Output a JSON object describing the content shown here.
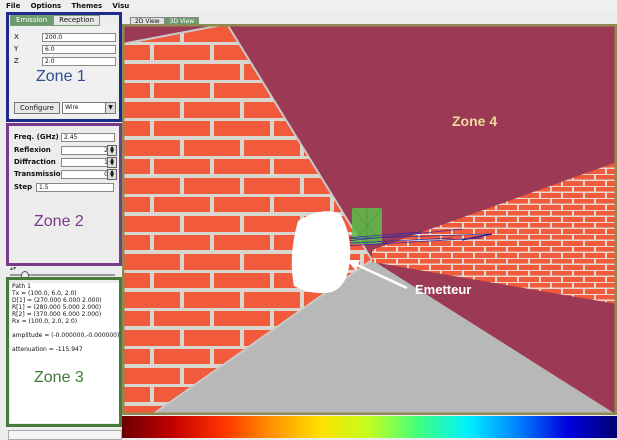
{
  "menu": [
    "File",
    "Options",
    "Themes",
    "Visu"
  ],
  "zone1": {
    "tabs": [
      "Emission",
      "Reception"
    ],
    "fields": [
      {
        "label": "X",
        "value": "200.0"
      },
      {
        "label": "Y",
        "value": "6.0"
      },
      {
        "label": "Z",
        "value": "2.0"
      }
    ],
    "title": "Zone 1",
    "configure": "Configure",
    "mode": "Wire",
    "border_color": "#1e2a8c"
  },
  "zone2": {
    "freq_label": "Freq. (GHz)",
    "freq_value": "2.45",
    "params": [
      {
        "label": "Reflexion",
        "value": "2"
      },
      {
        "label": "Diffraction",
        "value": "1"
      },
      {
        "label": "Transmission",
        "value": "0"
      }
    ],
    "step_label": "Step",
    "step_value": "1.5",
    "title": "Zone 2",
    "border_color": "#7a3a8c"
  },
  "zone3": {
    "lines": [
      "Path 1",
      "Tx = (100.0, 6.0, 2.0)",
      "D[1] = (270.000 6.000 2.000)",
      "R[1] = (280.000 5.000 2.000)",
      "R[2] = (370.000 6.000 2.000)",
      "Rx = (100.0, 2.0, 2.0)",
      "",
      "amplitude = (-0.000000,-0.000000)",
      "",
      "attenuation = -115.947"
    ],
    "title": "Zone 3",
    "border_color": "#4a7a3a"
  },
  "viewport": {
    "tabs": [
      "2D View",
      "3D View"
    ],
    "zone4_label": "Zone 4",
    "emitter_label": "Emetteur",
    "border_color": "#8f8a52"
  },
  "colors": {
    "sky": "#9c3a55",
    "brick": "#f15a3a",
    "mortar": "#d9d6d0",
    "floor": "#b8b8b8"
  }
}
